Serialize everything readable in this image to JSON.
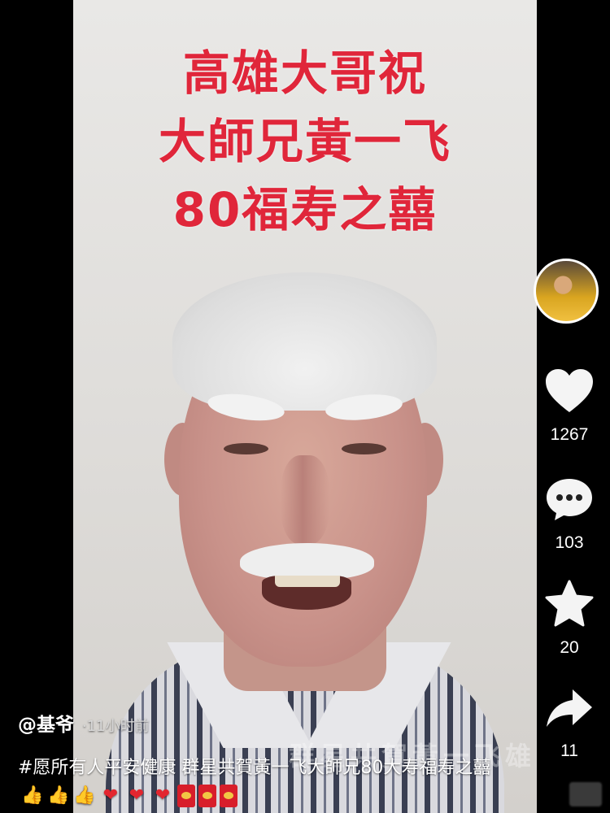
{
  "video": {
    "title_lines": [
      "高雄大哥祝",
      "大師兄黃一飞",
      "80福寿之囍"
    ],
    "watermark": "群星共賀黃一飞雄"
  },
  "author": {
    "handle": "@基爷",
    "time": "·11小时前"
  },
  "description": {
    "text": "#愿所有人平安健康 群星共賀黃一飞大師兄80大寿福寿之囍",
    "emojis": [
      "thumbs-up",
      "thumbs-up",
      "thumbs-up",
      "heart",
      "heart",
      "heart",
      "red-envelope",
      "red-envelope",
      "red-envelope"
    ]
  },
  "actions": {
    "likes": "1267",
    "comments": "103",
    "favorites": "20",
    "shares": "11"
  },
  "colors": {
    "title_red": "#e0263a",
    "background": "#000000"
  }
}
